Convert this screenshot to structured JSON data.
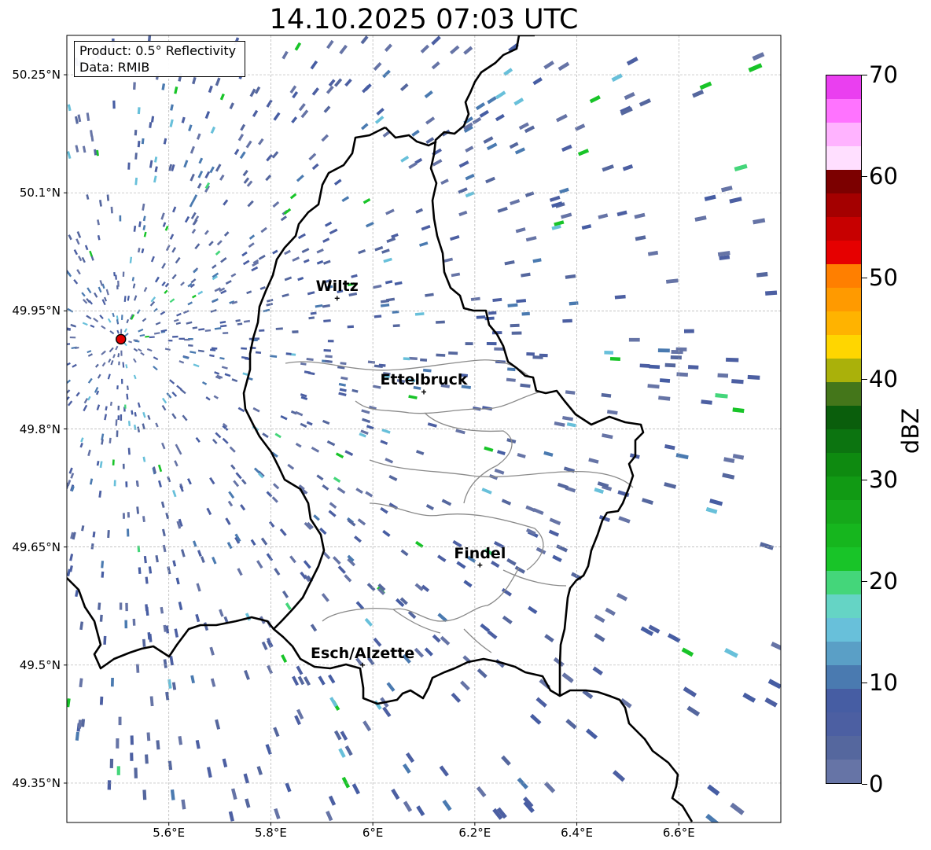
{
  "title": "14.10.2025 07:03 UTC",
  "info": {
    "product": "Product: 0.5° Reflectivity",
    "source": "Data: RMIB"
  },
  "map": {
    "lon_range": [
      5.4,
      6.8
    ],
    "lat_range": [
      49.3,
      50.3
    ],
    "radar_site": {
      "lon": 5.506,
      "lat": 49.914
    },
    "lat_ticks": [
      {
        "value": 50.25,
        "label": "50.25°N"
      },
      {
        "value": 50.1,
        "label": "50.1°N"
      },
      {
        "value": 49.95,
        "label": "49.95°N"
      },
      {
        "value": 49.8,
        "label": "49.8°N"
      },
      {
        "value": 49.65,
        "label": "49.65°N"
      },
      {
        "value": 49.5,
        "label": "49.5°N"
      },
      {
        "value": 49.35,
        "label": "49.35°N"
      }
    ],
    "lon_ticks": [
      {
        "value": 5.6,
        "label": "5.6°E"
      },
      {
        "value": 5.8,
        "label": "5.8°E"
      },
      {
        "value": 6.0,
        "label": "6°E"
      },
      {
        "value": 6.2,
        "label": "6.2°E"
      },
      {
        "value": 6.4,
        "label": "6.4°E"
      },
      {
        "value": 6.6,
        "label": "6.6°E"
      }
    ],
    "cities": [
      {
        "name": "Wiltz",
        "lon": 5.93,
        "lat": 49.966
      },
      {
        "name": "Ettelbruck",
        "lon": 6.1,
        "lat": 49.847
      },
      {
        "name": "Findel",
        "lon": 6.21,
        "lat": 49.627
      },
      {
        "name": "Esch/Alzette",
        "lon": 5.98,
        "lat": 49.5
      }
    ]
  },
  "colorbar": {
    "label": "dBZ",
    "min": 0,
    "max": 70,
    "ticks": [
      0,
      10,
      20,
      30,
      40,
      50,
      60,
      70
    ],
    "colors": [
      "#6674a6",
      "#55679e",
      "#4c5fa2",
      "#465da3",
      "#4a7ab0",
      "#5a9fc6",
      "#68c0da",
      "#65d4c5",
      "#44d67a",
      "#18c428",
      "#16b61e",
      "#15a81a",
      "#119a14",
      "#0e8a10",
      "#0c7410",
      "#0a5e0c",
      "#44761a",
      "#aab10a",
      "#ffd600",
      "#ffb300",
      "#ff9a00",
      "#ff7f00",
      "#e60000",
      "#c70000",
      "#a40000",
      "#7c0000",
      "#ffdfff",
      "#ffb3ff",
      "#ff73ff",
      "#ea3ff0"
    ]
  }
}
